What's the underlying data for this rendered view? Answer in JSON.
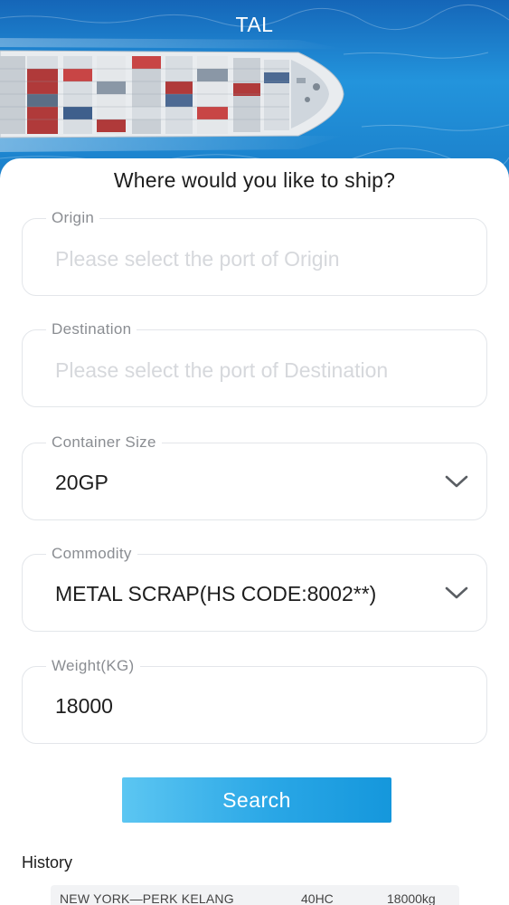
{
  "header": {
    "title": "TAL"
  },
  "form": {
    "heading": "Where would you like to ship?",
    "origin": {
      "label": "Origin",
      "placeholder": "Please select the port of Origin"
    },
    "destination": {
      "label": "Destination",
      "placeholder": "Please select the port of Destination"
    },
    "container_size": {
      "label": "Container Size",
      "value": "20GP"
    },
    "commodity": {
      "label": "Commodity",
      "value": "METAL SCRAP(HS CODE:8002**)"
    },
    "weight": {
      "label": "Weight(KG)",
      "value": "18000"
    },
    "search_label": "Search"
  },
  "history": {
    "label": "History",
    "items": [
      {
        "route": "NEW YORK—PERK KELANG",
        "size": "40HC",
        "weight": "18000kg"
      }
    ]
  },
  "colors": {
    "accent": "#2aa7e6",
    "sea": "#1f88d6",
    "border": "#e3e6ea",
    "placeholder": "#d6d8dc"
  }
}
